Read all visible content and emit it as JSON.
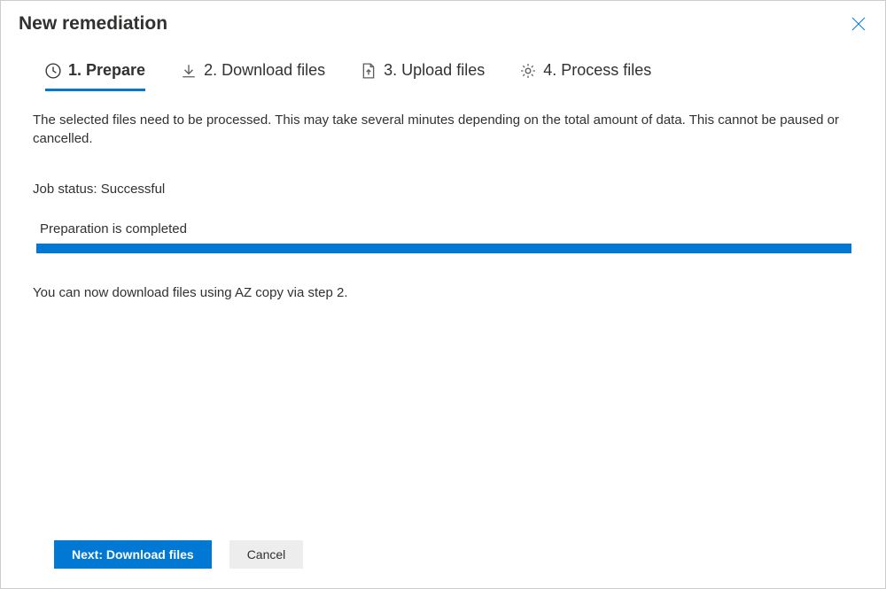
{
  "dialog": {
    "title": "New remediation"
  },
  "tabs": [
    {
      "label": "1. Prepare"
    },
    {
      "label": "2. Download files"
    },
    {
      "label": "3. Upload files"
    },
    {
      "label": "4. Process files"
    }
  ],
  "main": {
    "description": "The selected files need to be processed. This may take several minutes depending on the total amount of data. This cannot be paused or cancelled.",
    "job_status_label": "Job status:",
    "job_status_value": "Successful",
    "progress_label": "Preparation is completed",
    "progress_percent": 100,
    "hint": "You can now download files using AZ copy via step 2."
  },
  "buttons": {
    "next": "Next: Download files",
    "cancel": "Cancel"
  },
  "colors": {
    "primary": "#0078d4"
  }
}
